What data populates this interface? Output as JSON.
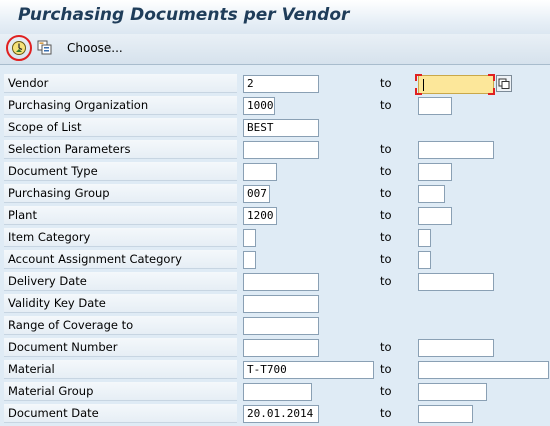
{
  "window": {
    "title": "Purchasing Documents per Vendor"
  },
  "toolbar": {
    "execute_icon": "execute-clock-icon",
    "choose_icon": "choose-layout-icon",
    "choose_label": "Choose..."
  },
  "to_label": "to",
  "rows": [
    {
      "label": "Vendor",
      "from": "2",
      "to": ""
    },
    {
      "label": "Purchasing Organization",
      "from": "1000",
      "to": ""
    },
    {
      "label": "Scope of List",
      "from": "BEST"
    },
    {
      "label": "Selection Parameters",
      "from": "",
      "to": ""
    },
    {
      "label": "Document Type",
      "from": "",
      "to": ""
    },
    {
      "label": "Purchasing Group",
      "from": "007",
      "to": ""
    },
    {
      "label": "Plant",
      "from": "1200",
      "to": ""
    },
    {
      "label": "Item Category",
      "from": "",
      "to": ""
    },
    {
      "label": "Account Assignment Category",
      "from": "",
      "to": ""
    },
    {
      "label": "Delivery Date",
      "from": "",
      "to": ""
    },
    {
      "label": "Validity Key Date",
      "from": ""
    },
    {
      "label": "Range of Coverage to",
      "from": ""
    },
    {
      "label": "Document Number",
      "from": "",
      "to": ""
    },
    {
      "label": "Material",
      "from": "T-T700",
      "to": ""
    },
    {
      "label": "Material Group",
      "from": "",
      "to": ""
    },
    {
      "label": "Document Date",
      "from": "20.01.2014",
      "to": ""
    }
  ]
}
